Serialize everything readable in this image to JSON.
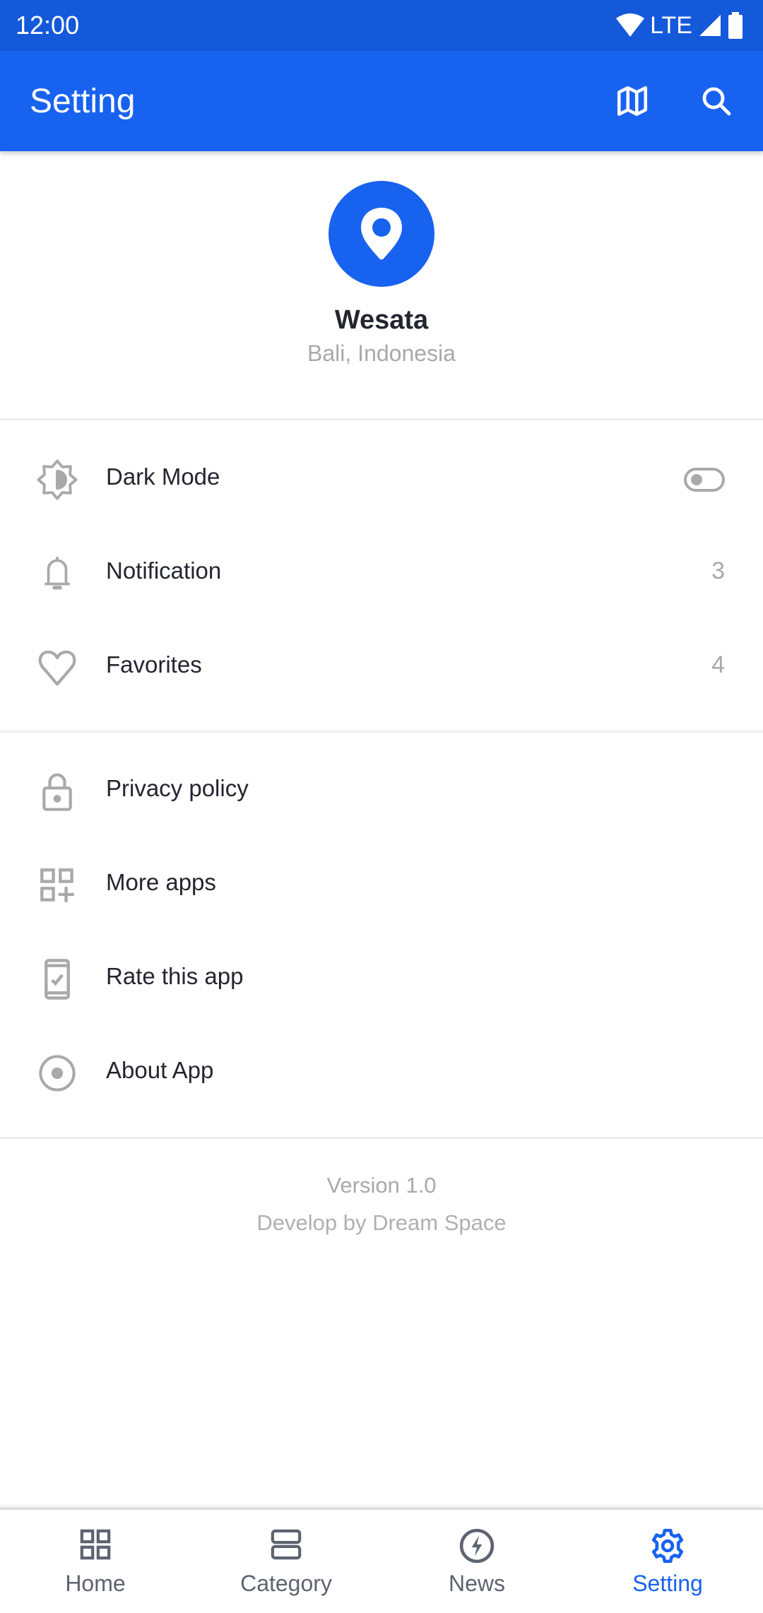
{
  "status_bar": {
    "time": "12:00",
    "network": "LTE",
    "icons": [
      "wifi-icon",
      "signal-icon",
      "battery-icon"
    ]
  },
  "app_bar": {
    "title": "Setting",
    "actions": [
      {
        "icon": "map-icon"
      },
      {
        "icon": "search-icon"
      }
    ]
  },
  "profile": {
    "icon": "location-pin-icon",
    "name": "Wesata",
    "location": "Bali, Indonesia"
  },
  "settings_group_1": [
    {
      "icon": "brightness-icon",
      "label": "Dark Mode",
      "type": "toggle",
      "toggled": false
    },
    {
      "icon": "bell-icon",
      "label": "Notification",
      "value": "3"
    },
    {
      "icon": "heart-icon",
      "label": "Favorites",
      "value": "4"
    }
  ],
  "settings_group_2": [
    {
      "icon": "lock-icon",
      "label": "Privacy policy"
    },
    {
      "icon": "add-apps-icon",
      "label": "More apps"
    },
    {
      "icon": "phone-check-icon",
      "label": "Rate this app"
    },
    {
      "icon": "radio-circle-icon",
      "label": "About App"
    }
  ],
  "footer": {
    "version": "Version 1.0",
    "developer": "Develop by Dream Space"
  },
  "bottom_nav": {
    "active": "Setting",
    "items": [
      {
        "icon": "grid-icon",
        "label": "Home"
      },
      {
        "icon": "category-icon",
        "label": "Category"
      },
      {
        "icon": "bolt-icon",
        "label": "News"
      },
      {
        "icon": "gear-icon",
        "label": "Setting"
      }
    ]
  },
  "colors": {
    "primary": "#1862f0",
    "status_bar": "#1459d9",
    "text": "#23262f",
    "muted": "#a9a9a9",
    "nav_inactive": "#5e6370"
  }
}
